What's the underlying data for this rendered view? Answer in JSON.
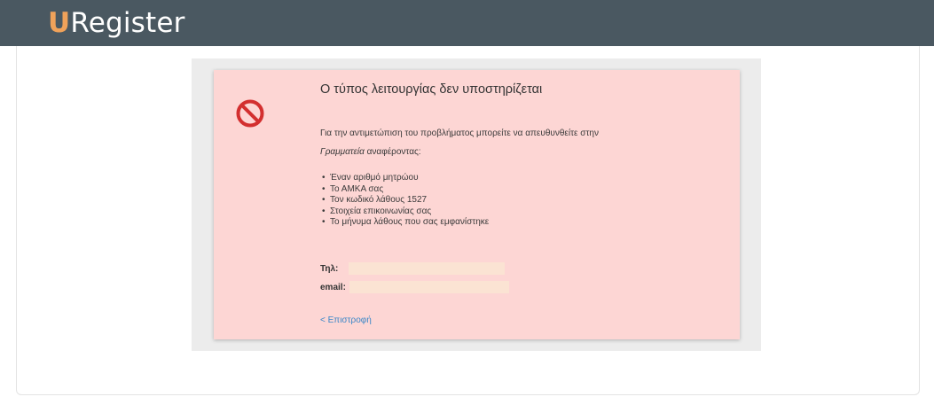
{
  "header": {
    "logo_mark": "U",
    "logo_text": "Register",
    "bar_color": "#4a5861",
    "mark_color": "#f0a25a"
  },
  "error": {
    "icon": "ban-icon",
    "icon_color": "#d32f2f",
    "background_color": "#fdd6d4",
    "title": "Ο τύπος λειτουργίας δεν υποστηρίζεται",
    "intro_text": "Για την αντιμετώπιση του προβλήματος μπορείτε να απευθυνθείτε στην",
    "intro_emphasis": "Γραμματεία",
    "intro_suffix": "αναφέροντας:",
    "items": [
      "Έναν αριθμό μητρώου",
      "Το ΑΜΚΑ σας",
      "Τον κωδικό λάθους 1527",
      "Στοιχεία επικοινωνίας σας",
      "Το μήνυμα λάθους που σας εμφανίστηκε"
    ],
    "tel_label": "Τηλ:",
    "email_label": "email:",
    "back_label": "< Επιστροφή",
    "link_color": "#3b87c8"
  }
}
